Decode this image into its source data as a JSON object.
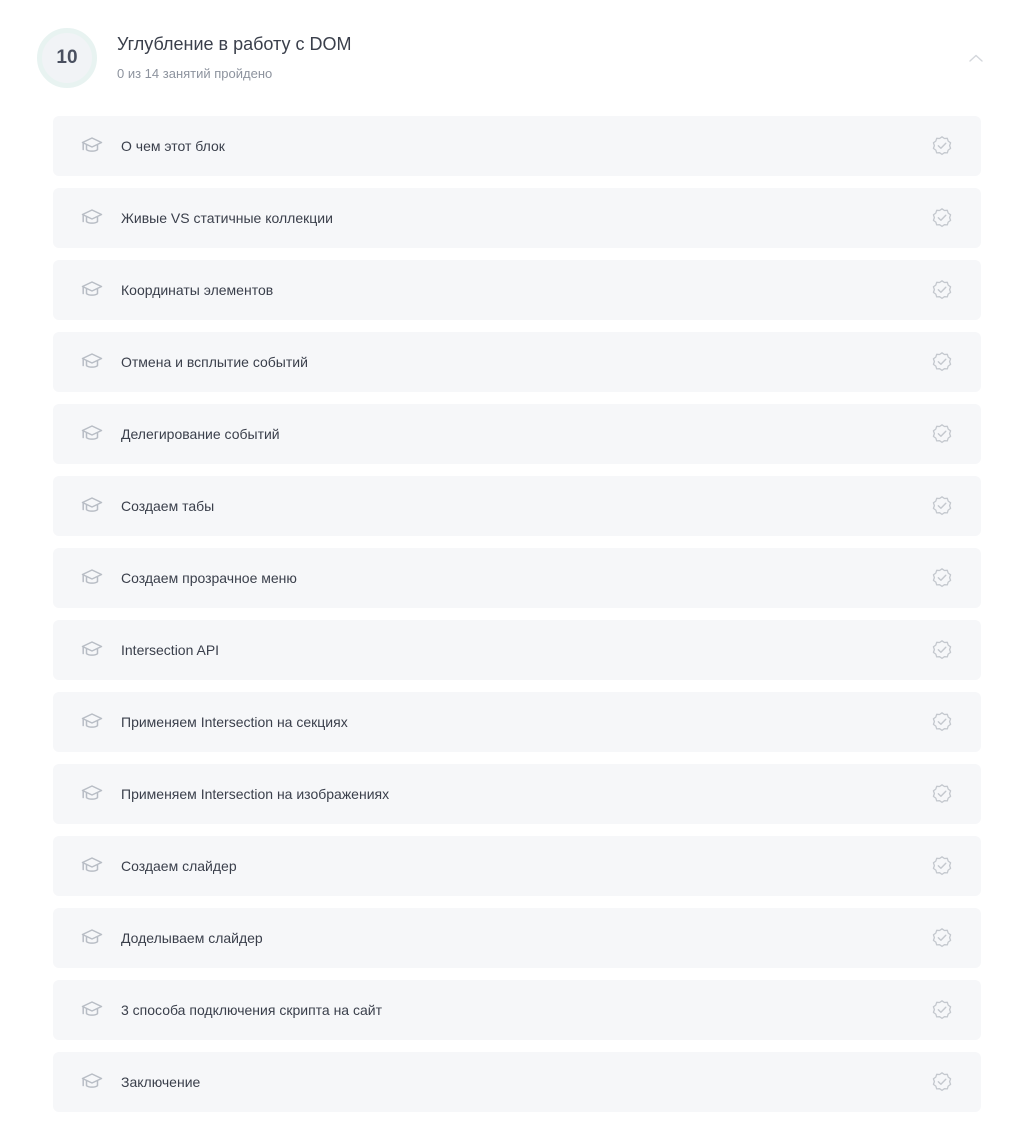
{
  "module": {
    "number": "10",
    "title": "Углубление в работу с DOM",
    "progress": "0 из 14 занятий пройдено",
    "toggle_icon": "chevron-up-icon",
    "accent_ring_color": "#e8f3f1"
  },
  "lessons": [
    {
      "title": "О чем этот блок",
      "icon": "graduation-cap-icon",
      "status_icon": "badge-check-icon",
      "completed": false
    },
    {
      "title": "Живые VS статичные коллекции",
      "icon": "graduation-cap-icon",
      "status_icon": "badge-check-icon",
      "completed": false
    },
    {
      "title": "Координаты элементов",
      "icon": "graduation-cap-icon",
      "status_icon": "badge-check-icon",
      "completed": false
    },
    {
      "title": "Отмена и всплытие событий",
      "icon": "graduation-cap-icon",
      "status_icon": "badge-check-icon",
      "completed": false
    },
    {
      "title": "Делегирование событий",
      "icon": "graduation-cap-icon",
      "status_icon": "badge-check-icon",
      "completed": false
    },
    {
      "title": "Создаем табы",
      "icon": "graduation-cap-icon",
      "status_icon": "badge-check-icon",
      "completed": false
    },
    {
      "title": "Создаем прозрачное меню",
      "icon": "graduation-cap-icon",
      "status_icon": "badge-check-icon",
      "completed": false
    },
    {
      "title": "Intersection API",
      "icon": "graduation-cap-icon",
      "status_icon": "badge-check-icon",
      "completed": false
    },
    {
      "title": "Применяем Intersection на секциях",
      "icon": "graduation-cap-icon",
      "status_icon": "badge-check-icon",
      "completed": false
    },
    {
      "title": "Применяем Intersection на изображениях",
      "icon": "graduation-cap-icon",
      "status_icon": "badge-check-icon",
      "completed": false
    },
    {
      "title": "Создаем слайдер",
      "icon": "graduation-cap-icon",
      "status_icon": "badge-check-icon",
      "completed": false
    },
    {
      "title": "Доделываем слайдер",
      "icon": "graduation-cap-icon",
      "status_icon": "badge-check-icon",
      "completed": false
    },
    {
      "title": "3 способа подключения скрипта на сайт",
      "icon": "graduation-cap-icon",
      "status_icon": "badge-check-icon",
      "completed": false
    },
    {
      "title": "Заключение",
      "icon": "graduation-cap-icon",
      "status_icon": "badge-check-icon",
      "completed": false
    }
  ]
}
